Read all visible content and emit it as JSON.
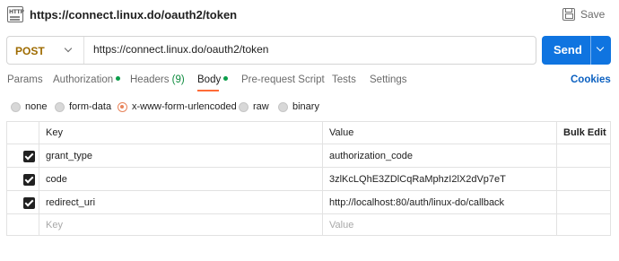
{
  "window": {
    "title": "https://connect.linux.do/oauth2/token",
    "save_label": "Save"
  },
  "request": {
    "method": "POST",
    "url": "https://connect.linux.do/oauth2/token",
    "send_label": "Send"
  },
  "tabs": {
    "params": "Params",
    "authorization": "Authorization",
    "headers": "Headers",
    "headers_count": "(9)",
    "body": "Body",
    "pre_request": "Pre-request Script",
    "tests": "Tests",
    "settings": "Settings",
    "cookies": "Cookies",
    "active": "Body"
  },
  "body_modes": {
    "none": "none",
    "form_data": "form-data",
    "urlencoded": "x-www-form-urlencoded",
    "raw": "raw",
    "binary": "binary",
    "selected": "x-www-form-urlencoded"
  },
  "table": {
    "headers": {
      "key": "Key",
      "value": "Value",
      "bulk_edit": "Bulk Edit"
    },
    "rows": [
      {
        "checked": true,
        "key": "grant_type",
        "value": "authorization_code"
      },
      {
        "checked": true,
        "key": "code",
        "value": "3zlKcLQhE3ZDlCqRaMphzI2lX2dVp7eT"
      },
      {
        "checked": true,
        "key": "redirect_uri",
        "value": "http://localhost:80/auth/linux-do/callback"
      }
    ],
    "placeholder": {
      "key": "Key",
      "value": "Value"
    }
  },
  "colors": {
    "send_button": "#0f74e0",
    "method": "#9e6b00",
    "active_tab_underline": "#ff6c37",
    "status_dot": "#0b9e4a",
    "cookies_link": "#0b60c0",
    "radio_selected": "#e8835a"
  },
  "icons": {
    "request_icon": "http-request-icon",
    "save_icon": "save-icon"
  }
}
